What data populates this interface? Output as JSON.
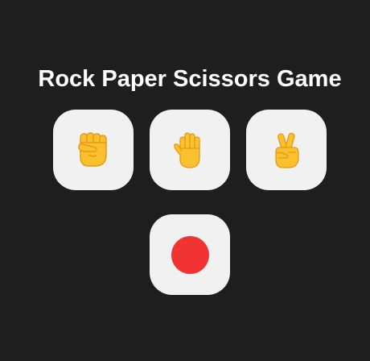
{
  "title": "Rock Paper Scissors Game",
  "choices": [
    {
      "id": "rock",
      "icon": "raised-fist-icon"
    },
    {
      "id": "paper",
      "icon": "raised-hand-icon"
    },
    {
      "id": "scissors",
      "icon": "victory-hand-icon"
    }
  ],
  "result": {
    "icon": "red-circle-icon"
  },
  "colors": {
    "background": "#1e1e1e",
    "tile": "#f1f1f1",
    "title": "#ffffff",
    "hand": "#fbc02d",
    "hand_outline": "#e39b17",
    "result_dot": "#f23333"
  }
}
